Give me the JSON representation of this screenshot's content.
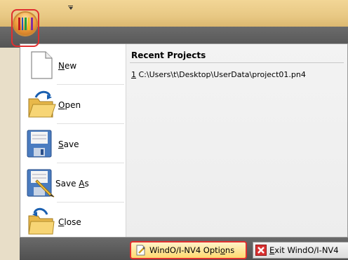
{
  "orb": {
    "icon": "app-orb-icon",
    "colors": [
      "#c02020",
      "#2050c0",
      "#20a040",
      "#f0c020",
      "#8030a0"
    ]
  },
  "qat": {
    "icon": "qat-dropdown-icon"
  },
  "menu": {
    "items": [
      {
        "key": "N",
        "rest": "ew",
        "icon": "new-document-icon"
      },
      {
        "key": "O",
        "rest": "pen",
        "icon": "open-folder-icon"
      },
      {
        "key": "S",
        "rest": "ave",
        "icon": "save-icon"
      },
      {
        "pre": "Save ",
        "key": "A",
        "rest": "s",
        "icon": "save-as-icon"
      },
      {
        "key": "C",
        "rest": "lose",
        "icon": "close-folder-icon"
      }
    ]
  },
  "recent": {
    "header": "Recent Projects",
    "projects": [
      {
        "num": "1",
        "path": " C:\\Users\\t\\Desktop\\UserData\\project01.pn4"
      }
    ]
  },
  "buttons": {
    "options": {
      "pre": "WindO/I-NV4 Opti",
      "key": "o",
      "rest": "ns",
      "icon": "options-icon"
    },
    "exit": {
      "key": "E",
      "rest": "xit WindO/I-NV4",
      "icon": "exit-icon"
    }
  },
  "colors": {
    "highlight": "#e03030",
    "title_bar": "#e8c884",
    "dark_band": "#555555"
  }
}
